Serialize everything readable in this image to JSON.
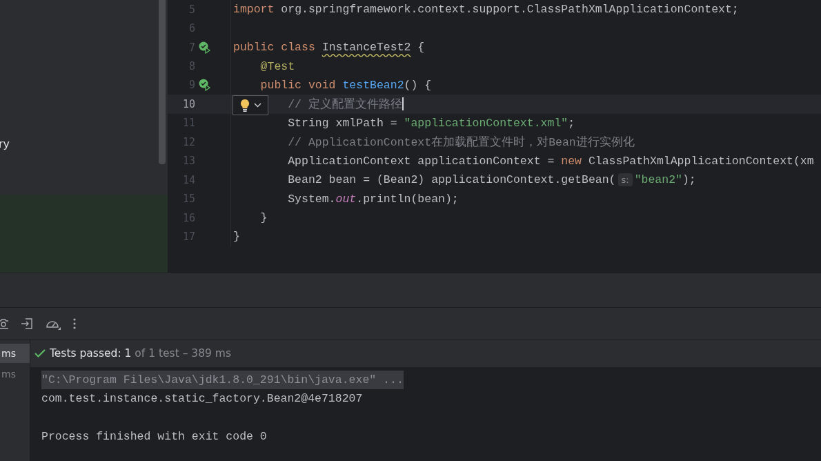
{
  "project_panel": {
    "items": [
      {
        "label": "ry",
        "selected": false
      }
    ],
    "highlight": true
  },
  "editor": {
    "lines": [
      {
        "number": "5",
        "test_icon": false,
        "current": false,
        "tokens": [
          {
            "kind": "keyword",
            "text": "import"
          },
          {
            "kind": "plain",
            "text": " org.springframework.context.support.ClassPathXmlApplicationContext;"
          }
        ]
      },
      {
        "number": "6",
        "test_icon": false,
        "current": false
      },
      {
        "number": "7",
        "test_icon": true,
        "current": false,
        "tokens": [
          {
            "kind": "keyword",
            "text": "public class "
          },
          {
            "kind": "class-warning",
            "text": "InstanceTest2"
          },
          {
            "kind": "plain",
            "text": " {"
          }
        ]
      },
      {
        "number": "8",
        "test_icon": false,
        "current": false,
        "tokens": [
          {
            "kind": "annotation",
            "text": "    @Test"
          }
        ]
      },
      {
        "number": "9",
        "test_icon": true,
        "current": false,
        "tokens": [
          {
            "kind": "keyword",
            "text": "    public void "
          },
          {
            "kind": "method",
            "text": "testBean2"
          },
          {
            "kind": "plain",
            "text": "() {"
          }
        ]
      },
      {
        "number": "10",
        "test_icon": false,
        "current": true,
        "tokens": [
          {
            "kind": "comment",
            "text": "        // 定义配置文件路径"
          }
        ]
      },
      {
        "number": "11",
        "test_icon": false,
        "current": false,
        "tokens": [
          {
            "kind": "plain",
            "text": "        String xmlPath = "
          },
          {
            "kind": "string",
            "text": "\"applicationContext.xml\""
          },
          {
            "kind": "plain",
            "text": ";"
          }
        ]
      },
      {
        "number": "12",
        "test_icon": false,
        "current": false,
        "tokens": [
          {
            "kind": "comment",
            "text": "        // ApplicationContext在加载配置文件时，对Bean进行实例化"
          }
        ]
      },
      {
        "number": "13",
        "test_icon": false,
        "current": false,
        "tokens": [
          {
            "kind": "plain",
            "text": "        ApplicationContext applicationContext = "
          },
          {
            "kind": "keyword",
            "text": "new"
          },
          {
            "kind": "plain",
            "text": " ClassPathXmlApplicationContext(xm"
          }
        ]
      },
      {
        "number": "14",
        "test_icon": false,
        "current": false,
        "tokens": [
          {
            "kind": "plain",
            "text": "        Bean2 bean = (Bean2) applicationContext.getBean("
          },
          {
            "kind": "hint",
            "text": "s:"
          },
          {
            "kind": "string",
            "text": "\"bean2\""
          },
          {
            "kind": "plain",
            "text": ");"
          }
        ]
      },
      {
        "number": "15",
        "test_icon": false,
        "current": false,
        "tokens": [
          {
            "kind": "plain",
            "text": "        System."
          },
          {
            "kind": "static",
            "text": "out"
          },
          {
            "kind": "plain",
            "text": ".println(bean);"
          }
        ]
      },
      {
        "number": "16",
        "test_icon": false,
        "current": false,
        "tokens": [
          {
            "kind": "plain",
            "text": "    }"
          }
        ]
      },
      {
        "number": "17",
        "test_icon": false,
        "current": false,
        "tokens": [
          {
            "kind": "plain",
            "text": "}"
          }
        ]
      }
    ]
  },
  "run_panel": {
    "toolbar": [
      {
        "kind": "camera"
      },
      {
        "kind": "exit"
      },
      {
        "kind": "gauge"
      },
      {
        "kind": "more"
      }
    ],
    "tests": [
      {
        "label": "ms",
        "selected": true
      },
      {
        "label": "ms",
        "selected": false
      }
    ],
    "status": {
      "passed": true,
      "label": "Tests passed:",
      "count": "1",
      "detail": "of 1 test – 389 ms"
    },
    "console": [
      {
        "kind": "command",
        "text": "\"C:\\Program Files\\Java\\jdk1.8.0_291\\bin\\java.exe\" ..."
      },
      {
        "kind": "output",
        "text": "com.test.instance.static_factory.Bean2@4e718207"
      },
      {
        "kind": "exit",
        "text": "Process finished with exit code 0"
      }
    ]
  }
}
